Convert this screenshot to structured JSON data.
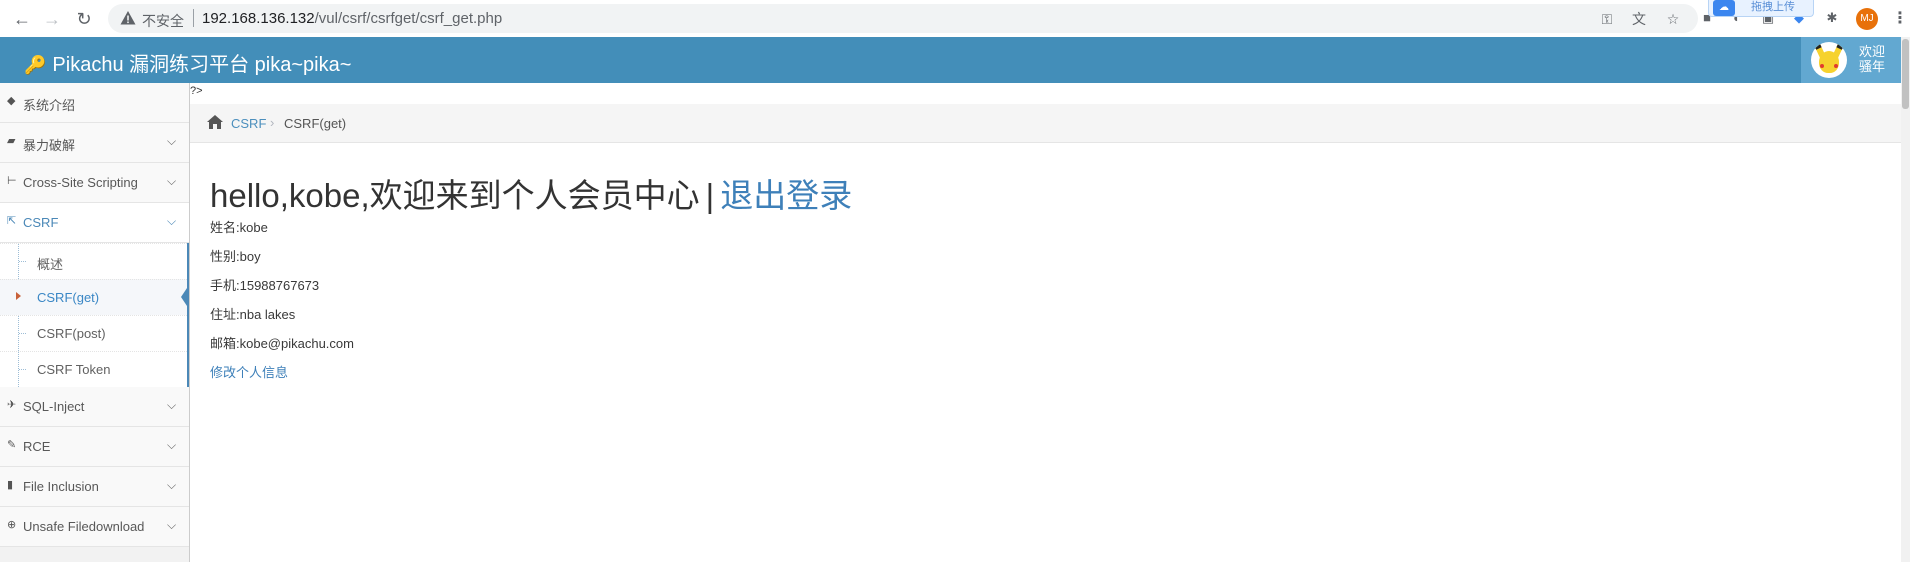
{
  "browser": {
    "security_label": "不安全",
    "url_host": "192.168.136.132",
    "url_path": "/vul/csrf/csrfget/csrf_get.php",
    "upload_label": "拖拽上传",
    "profile_initials": "MJ"
  },
  "header": {
    "brand": "Pikachu 漏洞练习平台 pika~pika~",
    "welcome": "欢迎 骚年"
  },
  "sidebar": {
    "items": [
      {
        "label": "系统介绍",
        "icon": "tag-icon"
      },
      {
        "label": "暴力破解",
        "icon": "lock-icon"
      },
      {
        "label": "Cross-Site Scripting",
        "icon": "sitemap-icon"
      },
      {
        "label": "CSRF",
        "icon": "share-icon"
      },
      {
        "label": "SQL-Inject",
        "icon": "plane-icon"
      },
      {
        "label": "RCE",
        "icon": "pencil-icon"
      },
      {
        "label": "File Inclusion",
        "icon": "file-icon"
      },
      {
        "label": "Unsafe Filedownload",
        "icon": "download-icon"
      }
    ],
    "csrf_submenu": [
      {
        "label": "概述"
      },
      {
        "label": "CSRF(get)",
        "active": true
      },
      {
        "label": "CSRF(post)"
      },
      {
        "label": "CSRF Token"
      }
    ]
  },
  "main": {
    "stray_text": "?>",
    "breadcrumb": {
      "parent": "CSRF",
      "current": "CSRF(get)"
    },
    "greeting": "hello,kobe,欢迎来到个人会员中心",
    "separator": "|",
    "logout": "退出登录",
    "profile": {
      "name": "姓名:kobe",
      "gender": "性别:boy",
      "phone": "手机:15988767673",
      "address": "住址:nba lakes",
      "email": "邮箱:kobe@pikachu.com"
    },
    "edit_link": "修改个人信息"
  },
  "colors": {
    "header_bg": "#438eb9",
    "link": "#3e80b9",
    "sidebar_active": "#4b88b7"
  }
}
